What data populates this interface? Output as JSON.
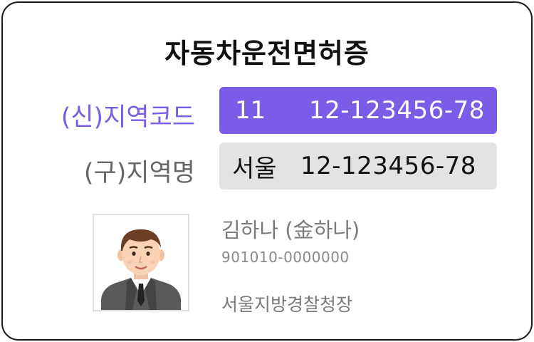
{
  "card": {
    "title": "자동차운전면허증",
    "new_region": {
      "label": "(신)지역코드",
      "region": "11",
      "number": "12-123456-78"
    },
    "old_region": {
      "label": "(구)지역명",
      "region": "서울",
      "number": "12-123456-78"
    },
    "holder": {
      "name": "김하나 (金하나)",
      "rrn": "901010-0000000",
      "issuer": "서울지방경찰청장"
    }
  },
  "colors": {
    "accent": "#7b5ce6",
    "old_box": "#e3e3e3",
    "border": "#1e1e1e"
  },
  "icons": {
    "photo": "person-avatar-icon"
  }
}
